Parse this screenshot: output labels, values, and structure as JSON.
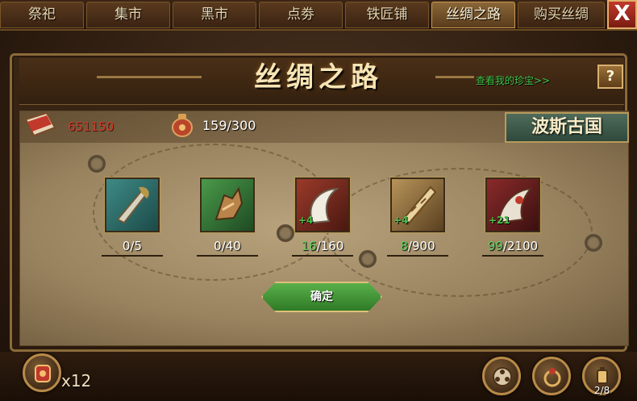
{
  "tabs": [
    {
      "label": "祭祀"
    },
    {
      "label": "集市"
    },
    {
      "label": "黑市"
    },
    {
      "label": "点劵"
    },
    {
      "label": "铁匠铺"
    },
    {
      "label": "丝绸之路"
    },
    {
      "label": "购买丝绸"
    }
  ],
  "active_tab": "丝绸之路",
  "close_label": "X",
  "window": {
    "title": "丝绸之路",
    "view_link": "查看我的珍宝>>",
    "help_label": "?"
  },
  "resources": {
    "book_value": "651150",
    "bag_value": "159/300"
  },
  "region": "波斯古国",
  "items": [
    {
      "icon": "dagger-icon",
      "have": "0",
      "need": "/5",
      "bonus": ""
    },
    {
      "icon": "claw-gauntlet-icon",
      "have": "0",
      "need": "/40",
      "bonus": ""
    },
    {
      "icon": "curved-blade-icon",
      "have": "16",
      "need": "/160",
      "bonus": "+4"
    },
    {
      "icon": "serrated-blade-icon",
      "have": "8",
      "need": "/900",
      "bonus": "+4"
    },
    {
      "icon": "horn-blade-icon",
      "have": "99",
      "need": "/2100",
      "bonus": "+21"
    }
  ],
  "confirm_label": "确定",
  "bottom": {
    "multiplier": "x12",
    "page": "2/8"
  },
  "colors": {
    "accent_gold": "#b89a5a",
    "have_green": "#5cd35c",
    "resource_red": "#d23a2a",
    "link_green": "#3ec24a",
    "close_red": "#c0392b"
  }
}
